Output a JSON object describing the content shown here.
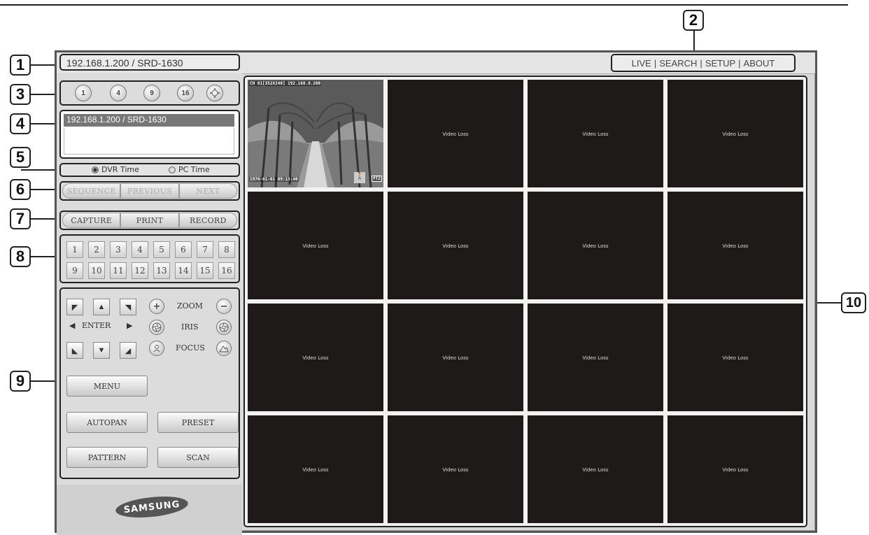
{
  "window": {
    "address": "192.168.1.200 / SRD-1630",
    "nav": [
      "LIVE",
      "SEARCH",
      "SETUP",
      "ABOUT"
    ]
  },
  "callouts": [
    "1",
    "2",
    "3",
    "4",
    "5",
    "6",
    "7",
    "8",
    "9",
    "10"
  ],
  "split_buttons": [
    "1",
    "4",
    "9",
    "16"
  ],
  "device_list": [
    "192.168.1.200  / SRD-1630"
  ],
  "time_sync": {
    "dvr_label": "DVR Time",
    "pc_label": "PC Time",
    "selected": "DVR Time"
  },
  "sequence_row": [
    "SEQUENCE",
    "PREVIOUS",
    "NEXT"
  ],
  "capture_row": [
    "CAPTURE",
    "PRINT",
    "RECORD"
  ],
  "channels": [
    "1",
    "2",
    "3",
    "4",
    "5",
    "6",
    "7",
    "8",
    "9",
    "10",
    "11",
    "12",
    "13",
    "14",
    "15",
    "16"
  ],
  "ptz": {
    "enter": "ENTER",
    "zoom": "ZOOM",
    "iris": "IRIS",
    "focus": "FOCUS",
    "menu": "MENU",
    "autopan": "AUTOPAN",
    "preset": "PRESET",
    "pattern": "PATTERN",
    "scan": "SCAN"
  },
  "brand": "SAMSUNG",
  "live_tile": {
    "header": "CH 01[352X240] 192.168.0.200",
    "timestamp": "1970-01-01 09:13:40",
    "ptz_tag": "PTZ"
  },
  "video_loss_label": "Video Loss"
}
